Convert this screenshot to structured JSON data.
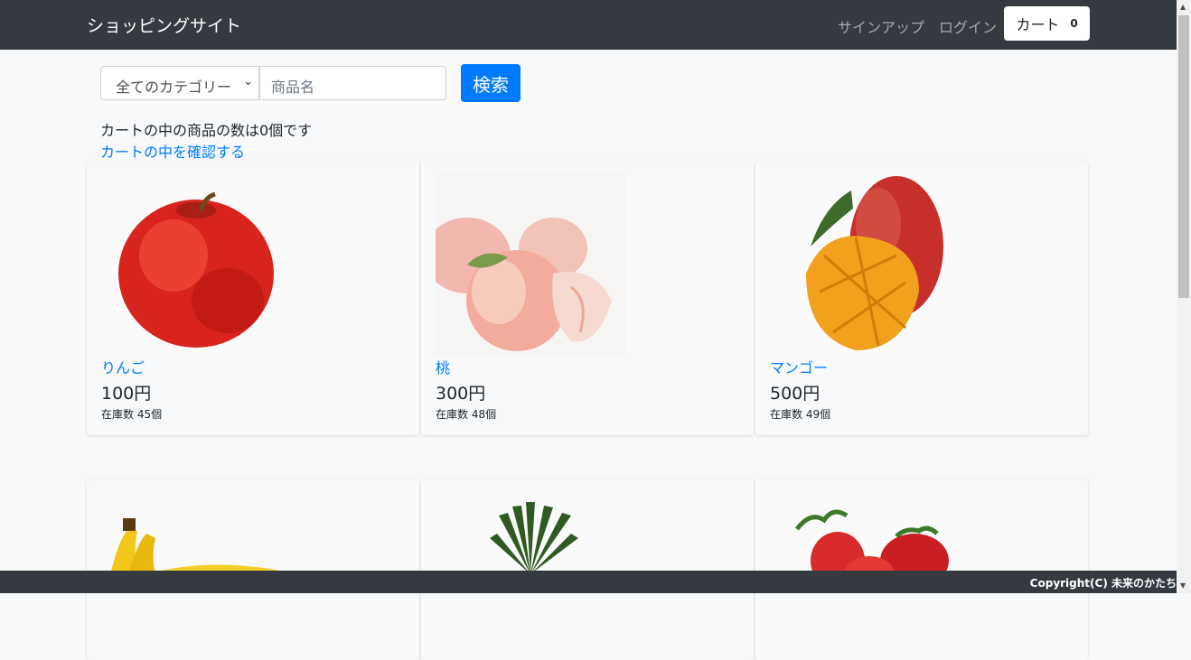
{
  "navbar": {
    "brand": "ショッピングサイト",
    "signup": "サインアップ",
    "login": "ログイン",
    "cart_label": "カート",
    "cart_count": "0"
  },
  "search": {
    "category": "全てのカテゴリー",
    "placeholder": "商品名",
    "button": "検索"
  },
  "cart_info": {
    "count_text": "カートの中の商品の数は0個です",
    "view_link": "カートの中を確認する"
  },
  "products": [
    {
      "name": "りんご",
      "price": "100円",
      "stock": "在庫数 45個"
    },
    {
      "name": "桃",
      "price": "300円",
      "stock": "在庫数 48個"
    },
    {
      "name": "マンゴー",
      "price": "500円",
      "stock": "在庫数 49個"
    },
    {
      "name": "",
      "price": "",
      "stock": ""
    },
    {
      "name": "",
      "price": "",
      "stock": ""
    },
    {
      "name": "",
      "price": "",
      "stock": ""
    }
  ],
  "footer": {
    "copyright": "Copyright(C) 未来のかたち"
  }
}
